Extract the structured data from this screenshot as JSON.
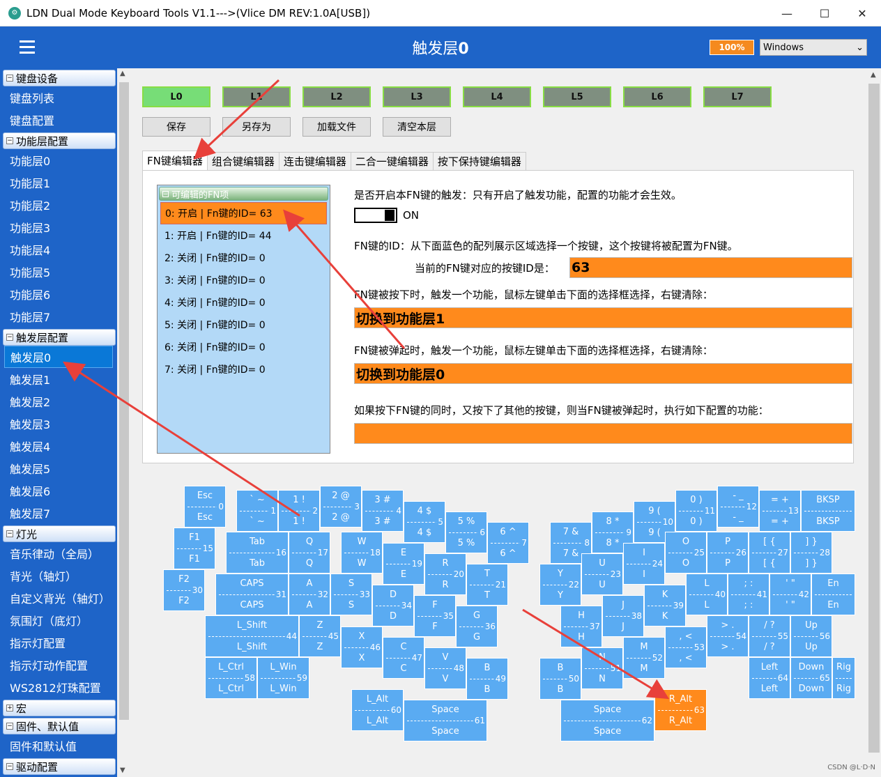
{
  "window": {
    "title": "LDN Dual Mode Keyboard Tools V1.1--->(Vlice DM REV:1.0A[USB])",
    "controls": [
      "—",
      "☐",
      "✕"
    ]
  },
  "header": {
    "title": "触发层",
    "title_num": "0",
    "zoom": "100%",
    "os_selected": "Windows"
  },
  "sidebar": {
    "groups": [
      {
        "label": "键盘设备",
        "items": [
          "键盘列表",
          "键盘配置"
        ]
      },
      {
        "label": "功能层配置",
        "items": [
          "功能层0",
          "功能层1",
          "功能层2",
          "功能层3",
          "功能层4",
          "功能层5",
          "功能层6",
          "功能层7"
        ]
      },
      {
        "label": "触发层配置",
        "items": [
          "触发层0",
          "触发层1",
          "触发层2",
          "触发层3",
          "触发层4",
          "触发层5",
          "触发层6",
          "触发层7"
        ]
      },
      {
        "label": "灯光",
        "items": [
          "音乐律动（全局）",
          "背光（轴灯）",
          "自定义背光（轴灯）",
          "氛围灯（底灯）",
          "指示灯配置",
          "指示灯动作配置",
          "WS2812灯珠配置"
        ]
      },
      {
        "label": "宏",
        "items": [],
        "collapsed": true
      },
      {
        "label": "固件、默认值",
        "items": [
          "固件和默认值"
        ]
      },
      {
        "label": "驱动配置",
        "items": []
      }
    ],
    "selected": "触发层0"
  },
  "layers": [
    "L0",
    "L1",
    "L2",
    "L3",
    "L4",
    "L5",
    "L6",
    "L7"
  ],
  "actions": [
    "保存",
    "另存为",
    "加载文件",
    "清空本层"
  ],
  "tabs": [
    "FN键编辑器",
    "组合键编辑器",
    "连击键编辑器",
    "二合一键编辑器",
    "按下保持键编辑器"
  ],
  "fn_list": {
    "header": "可编辑的FN项",
    "items": [
      "0: 开启 | Fn键的ID= 63",
      "1: 开启 | Fn键的ID= 44",
      "2: 关闭 | Fn键的ID= 0",
      "3: 关闭 | Fn键的ID= 0",
      "4: 关闭 | Fn键的ID= 0",
      "5: 关闭 | Fn键的ID= 0",
      "6: 关闭 | Fn键的ID= 0",
      "7: 关闭 | Fn键的ID= 0"
    ]
  },
  "fn_editor": {
    "enable_label": "是否开启本FN键的触发：只有开启了触发功能，配置的功能才会生效。",
    "toggle_state": "ON",
    "id_label": "FN键的ID：从下面蓝色的配列展示区域选择一个按键，这个按键将被配置为FN键。",
    "current_id_label": "当前的FN键对应的按键ID是：",
    "current_id": "63",
    "press_label": "FN键被按下时，触发一个功能，鼠标左键单击下面的选择框选择，右键清除：",
    "press_value": "切换到功能层1",
    "release_label": "FN键被弹起时，触发一个功能，鼠标左键单击下面的选择框选择，右键清除：",
    "release_value": "切换到功能层0",
    "combo_label": "如果按下FN键的同时，又按下了其他的按键，则当FN键被弹起时，执行如下配置的功能：",
    "combo_value": ""
  },
  "keys": [
    {
      "t": "Esc",
      "b": "Esc",
      "id": "0"
    },
    {
      "t": "` ~",
      "b": "` ~",
      "id": "1"
    },
    {
      "t": "1 !",
      "b": "1 !",
      "id": "2"
    },
    {
      "t": "2 @",
      "b": "2 @",
      "id": "3"
    },
    {
      "t": "3 #",
      "b": "3 #",
      "id": "4"
    },
    {
      "t": "4 $",
      "b": "4 $",
      "id": "5"
    },
    {
      "t": "5 %",
      "b": "5 %",
      "id": "6"
    },
    {
      "t": "6 ^",
      "b": "6 ^",
      "id": "7"
    },
    {
      "t": "7 &",
      "b": "7 &",
      "id": "8"
    },
    {
      "t": "8 *",
      "b": "8 *",
      "id": "9"
    },
    {
      "t": "9 (",
      "b": "9 (",
      "id": "10"
    },
    {
      "t": "0 )",
      "b": "0 )",
      "id": "11"
    },
    {
      "t": "- _",
      "b": "- _",
      "id": "12"
    },
    {
      "t": "= +",
      "b": "= +",
      "id": "13"
    },
    {
      "t": "BKSP",
      "b": "BKSP",
      "id": ""
    },
    {
      "t": "F1",
      "b": "F1",
      "id": "15"
    },
    {
      "t": "Tab",
      "b": "Tab",
      "id": "16"
    },
    {
      "t": "Q",
      "b": "Q",
      "id": "17"
    },
    {
      "t": "W",
      "b": "W",
      "id": "18"
    },
    {
      "t": "E",
      "b": "E",
      "id": "19"
    },
    {
      "t": "R",
      "b": "R",
      "id": "20"
    },
    {
      "t": "T",
      "b": "T",
      "id": "21"
    },
    {
      "t": "Y",
      "b": "Y",
      "id": "22"
    },
    {
      "t": "U",
      "b": "U",
      "id": "23"
    },
    {
      "t": "I",
      "b": "I",
      "id": "24"
    },
    {
      "t": "O",
      "b": "O",
      "id": "25"
    },
    {
      "t": "P",
      "b": "P",
      "id": "26"
    },
    {
      "t": "[ {",
      "b": "[ {",
      "id": "27"
    },
    {
      "t": "] }",
      "b": "] }",
      "id": "28"
    },
    {
      "t": "F2",
      "b": "F2",
      "id": "30"
    },
    {
      "t": "CAPS",
      "b": "CAPS",
      "id": "31"
    },
    {
      "t": "A",
      "b": "A",
      "id": "32"
    },
    {
      "t": "S",
      "b": "S",
      "id": "33"
    },
    {
      "t": "D",
      "b": "D",
      "id": "34"
    },
    {
      "t": "F",
      "b": "F",
      "id": "35"
    },
    {
      "t": "G",
      "b": "G",
      "id": "36"
    },
    {
      "t": "H",
      "b": "H",
      "id": "37"
    },
    {
      "t": "J",
      "b": "J",
      "id": "38"
    },
    {
      "t": "K",
      "b": "K",
      "id": "39"
    },
    {
      "t": "L",
      "b": "L",
      "id": "40"
    },
    {
      "t": "; :",
      "b": "; :",
      "id": "41"
    },
    {
      "t": "' \"",
      "b": "' \"",
      "id": "42"
    },
    {
      "t": "En",
      "b": "En",
      "id": ""
    },
    {
      "t": "L_Shift",
      "b": "L_Shift",
      "id": "44"
    },
    {
      "t": "Z",
      "b": "Z",
      "id": "45"
    },
    {
      "t": "X",
      "b": "X",
      "id": "46"
    },
    {
      "t": "C",
      "b": "C",
      "id": "47"
    },
    {
      "t": "V",
      "b": "V",
      "id": "48"
    },
    {
      "t": "B",
      "b": "B",
      "id": "49"
    },
    {
      "t": "B",
      "b": "B",
      "id": "50"
    },
    {
      "t": "N",
      "b": "N",
      "id": "51"
    },
    {
      "t": "M",
      "b": "M",
      "id": "52"
    },
    {
      "t": ", <",
      "b": ", <",
      "id": "53"
    },
    {
      "t": "> .",
      "b": "> .",
      "id": "54"
    },
    {
      "t": "/ ?",
      "b": "/ ?",
      "id": "55"
    },
    {
      "t": "Up",
      "b": "Up",
      "id": "56"
    },
    {
      "t": "L_Ctrl",
      "b": "L_Ctrl",
      "id": "58"
    },
    {
      "t": "L_Win",
      "b": "L_Win",
      "id": "59"
    },
    {
      "t": "L_Alt",
      "b": "L_Alt",
      "id": "60"
    },
    {
      "t": "Space",
      "b": "Space",
      "id": "61"
    },
    {
      "t": "Space",
      "b": "Space",
      "id": "62"
    },
    {
      "t": "R_Alt",
      "b": "R_Alt",
      "id": "63"
    },
    {
      "t": "Left",
      "b": "Left",
      "id": "64"
    },
    {
      "t": "Down",
      "b": "Down",
      "id": "65"
    },
    {
      "t": "Rig",
      "b": "Rig",
      "id": ""
    }
  ],
  "highlight_key_id": "63",
  "watermark": "CSDN @L·D·N",
  "colors": {
    "accent_blue": "#1e64c8",
    "highlight_orange": "#ff8a1c",
    "key_blue": "#5aabf2",
    "arrow_red": "#e8403a"
  }
}
